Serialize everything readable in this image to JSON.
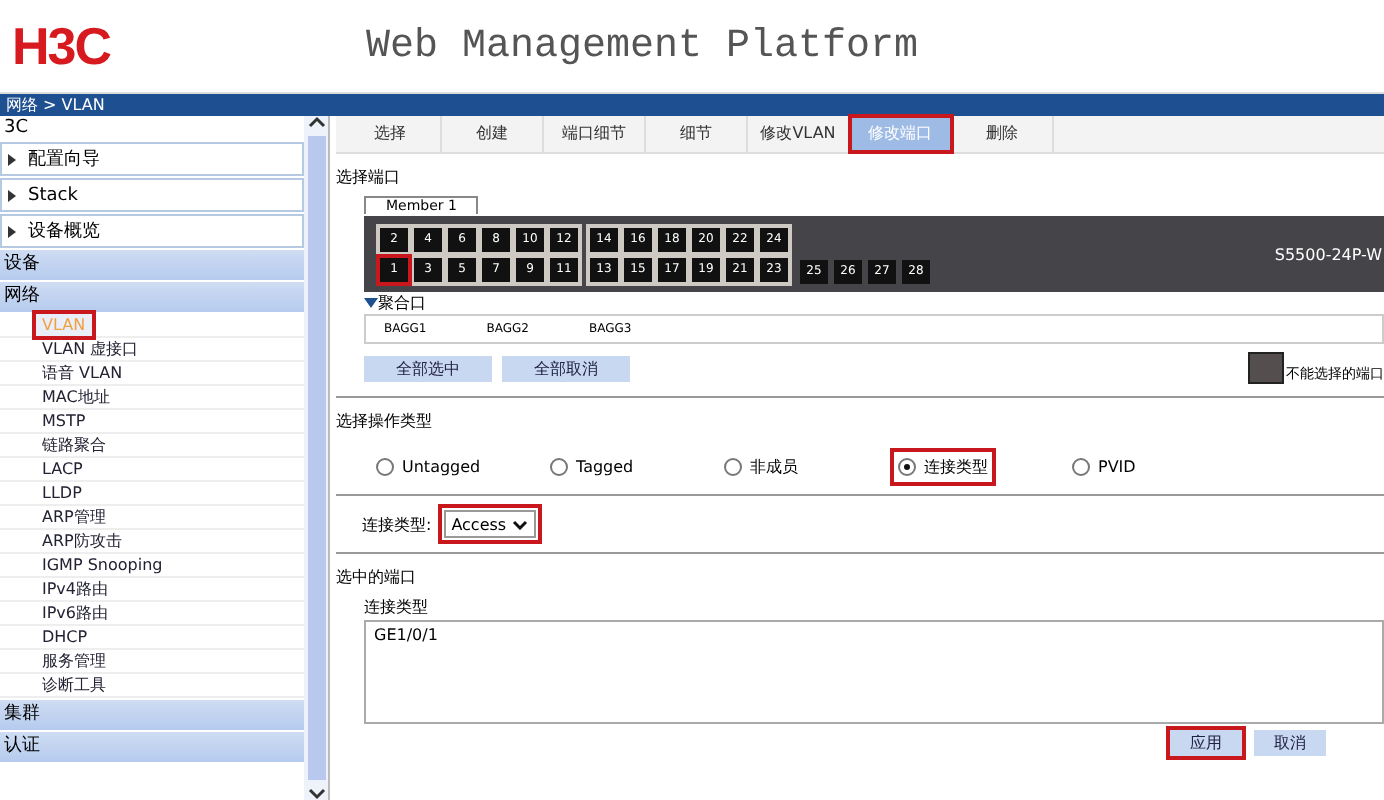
{
  "header": {
    "logo": "H3C",
    "title": "Web Management Platform"
  },
  "breadcrumb": "网络 > VLAN",
  "sidebar": {
    "root": "3C",
    "items": [
      {
        "kind": "folder",
        "label": "配置向导"
      },
      {
        "kind": "folder",
        "label": "Stack"
      },
      {
        "kind": "folder",
        "label": "设备概览"
      },
      {
        "kind": "section",
        "label": "设备"
      },
      {
        "kind": "section",
        "label": "网络",
        "children": [
          {
            "label": "VLAN",
            "selected": true,
            "highlighted": true
          },
          {
            "label": "VLAN 虚接口",
            "selected": false,
            "highlighted": false
          },
          {
            "label": "语音 VLAN",
            "selected": false,
            "highlighted": false
          },
          {
            "label": "MAC地址",
            "selected": false,
            "highlighted": false
          },
          {
            "label": "MSTP",
            "selected": false,
            "highlighted": false
          },
          {
            "label": "链路聚合",
            "selected": false,
            "highlighted": false
          },
          {
            "label": "LACP",
            "selected": false,
            "highlighted": false
          },
          {
            "label": "LLDP",
            "selected": false,
            "highlighted": false
          },
          {
            "label": "ARP管理",
            "selected": false,
            "highlighted": false
          },
          {
            "label": "ARP防攻击",
            "selected": false,
            "highlighted": false
          },
          {
            "label": "IGMP Snooping",
            "selected": false,
            "highlighted": false
          },
          {
            "label": "IPv4路由",
            "selected": false,
            "highlighted": false
          },
          {
            "label": "IPv6路由",
            "selected": false,
            "highlighted": false
          },
          {
            "label": "DHCP",
            "selected": false,
            "highlighted": false
          },
          {
            "label": "服务管理",
            "selected": false,
            "highlighted": false
          },
          {
            "label": "诊断工具",
            "selected": false,
            "highlighted": false
          }
        ]
      },
      {
        "kind": "section",
        "label": "集群"
      },
      {
        "kind": "section",
        "label": "认证"
      }
    ]
  },
  "tabs": [
    {
      "label": "选择",
      "selected": false,
      "highlighted": false
    },
    {
      "label": "创建",
      "selected": false,
      "highlighted": false
    },
    {
      "label": "端口细节",
      "selected": false,
      "highlighted": false
    },
    {
      "label": "细节",
      "selected": false,
      "highlighted": false
    },
    {
      "label": "修改VLAN",
      "selected": false,
      "highlighted": false
    },
    {
      "label": "修改端口",
      "selected": true,
      "highlighted": true
    },
    {
      "label": "删除",
      "selected": false,
      "highlighted": false
    }
  ],
  "port_section": {
    "title": "选择端口",
    "member_tab": "Member 1",
    "model": "S5500-24P-W",
    "top_ports": [
      {
        "label": "2",
        "selected": false
      },
      {
        "label": "4",
        "selected": false
      },
      {
        "label": "6",
        "selected": false
      },
      {
        "label": "8",
        "selected": false
      },
      {
        "label": "10",
        "selected": false
      },
      {
        "label": "12",
        "selected": false
      },
      {
        "label": "14",
        "selected": false
      },
      {
        "label": "16",
        "selected": false
      },
      {
        "label": "18",
        "selected": false
      },
      {
        "label": "20",
        "selected": false
      },
      {
        "label": "22",
        "selected": false
      },
      {
        "label": "24",
        "selected": false
      }
    ],
    "bottom_ports": [
      {
        "label": "1",
        "selected": true
      },
      {
        "label": "3",
        "selected": false
      },
      {
        "label": "5",
        "selected": false
      },
      {
        "label": "7",
        "selected": false
      },
      {
        "label": "9",
        "selected": false
      },
      {
        "label": "11",
        "selected": false
      },
      {
        "label": "13",
        "selected": false
      },
      {
        "label": "15",
        "selected": false
      },
      {
        "label": "17",
        "selected": false
      },
      {
        "label": "19",
        "selected": false
      },
      {
        "label": "21",
        "selected": false
      },
      {
        "label": "23",
        "selected": false
      }
    ],
    "extra_ports": [
      {
        "label": "25",
        "selected": false
      },
      {
        "label": "26",
        "selected": false
      },
      {
        "label": "27",
        "selected": false
      },
      {
        "label": "28",
        "selected": false
      }
    ],
    "aggregate_title": "聚合口",
    "aggregates": [
      "BAGG1",
      "BAGG2",
      "BAGG3"
    ],
    "buttons": [
      "全部选中",
      "全部取消"
    ],
    "legend": "不能选择的端口"
  },
  "operation": {
    "title": "选择操作类型",
    "options": [
      {
        "label": "Untagged",
        "selected": false,
        "highlighted": false
      },
      {
        "label": "Tagged",
        "selected": false,
        "highlighted": false
      },
      {
        "label": "非成员",
        "selected": false,
        "highlighted": false
      },
      {
        "label": "连接类型",
        "selected": true,
        "highlighted": true
      },
      {
        "label": "PVID",
        "selected": false,
        "highlighted": false
      }
    ],
    "link_type_label": "连接类型:",
    "link_type_value": "Access"
  },
  "selected_ports": {
    "title": "选中的端口",
    "column": "连接类型",
    "value": "GE1/0/1"
  },
  "actions": [
    {
      "label": "应用",
      "highlighted": true
    },
    {
      "label": "取消",
      "highlighted": false
    }
  ]
}
